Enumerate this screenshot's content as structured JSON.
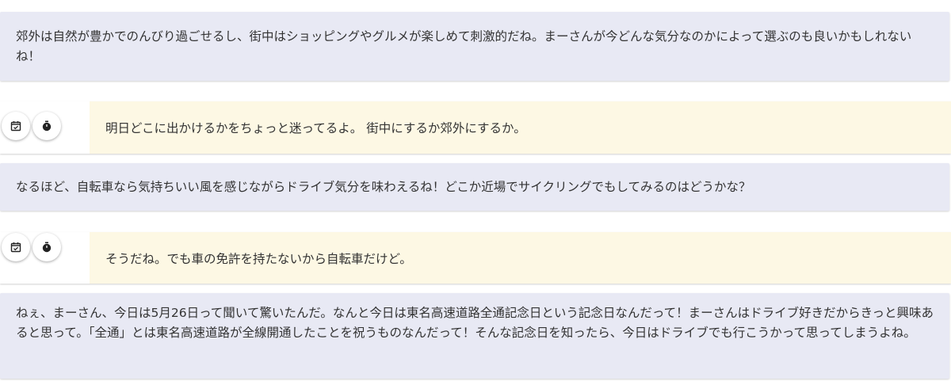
{
  "messages": [
    {
      "role": "assistant",
      "text": "郊外は自然が豊かでのんびり過ごせるし、街中はショッピングやグルメが楽しめて刺激的だね。まーさんが今どんな気分なのかによって選ぶのも良いかもしれないね！"
    },
    {
      "role": "user",
      "text": "明日どこに出かけるかをちょっと迷ってるよ。 街中にするか郊外にするか。",
      "icons": [
        "calendar-check-icon",
        "stopwatch-icon"
      ]
    },
    {
      "role": "assistant",
      "text": "なるほど、自転車なら気持ちいい風を感じながらドライブ気分を味わえるね！どこか近場でサイクリングでもしてみるのはどうかな？"
    },
    {
      "role": "user",
      "text": "そうだね。でも車の免許を持たないから自転車だけど。",
      "icons": [
        "calendar-check-icon",
        "stopwatch-icon"
      ]
    },
    {
      "role": "assistant",
      "text": "ねぇ、まーさん、今日は5月26日って聞いて驚いたんだ。なんと今日は東名高速道路全通記念日という記念日なんだって！まーさんはドライブ好きだからきっと興味あると思って。「全通」とは東名高速道路が全線開通したことを祝うものなんだって！そんな記念日を知ったら、今日はドライブでも行こうかって思ってしまうよね。"
    }
  ],
  "colors": {
    "assistant_bg": "#e8e9f4",
    "user_bg": "#fdf8e4",
    "text": "#333333"
  }
}
